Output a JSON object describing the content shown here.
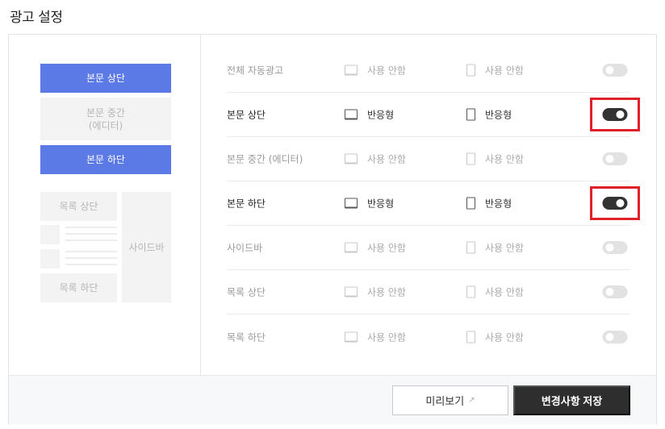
{
  "page": {
    "title": "광고 설정"
  },
  "preview": {
    "top": "본문 상단",
    "middle_line1": "본문 중간",
    "middle_line2": "(에디터)",
    "bottom": "본문 하단",
    "list_top": "목록 상단",
    "list_bottom": "목록 하단",
    "sidebar": "사이드바"
  },
  "rows": [
    {
      "label": "전체 자동광고",
      "pc": "사용 안함",
      "mobile": "사용 안함",
      "enabled": false
    },
    {
      "label": "본문 상단",
      "pc": "반응형",
      "mobile": "반응형",
      "enabled": true
    },
    {
      "label": "본문 중간 (에디터)",
      "pc": "사용 안함",
      "mobile": "사용 안함",
      "enabled": false
    },
    {
      "label": "본문 하단",
      "pc": "반응형",
      "mobile": "반응형",
      "enabled": true
    },
    {
      "label": "사이드바",
      "pc": "사용 안함",
      "mobile": "사용 안함",
      "enabled": false
    },
    {
      "label": "목록 상단",
      "pc": "사용 안함",
      "mobile": "사용 안함",
      "enabled": false
    },
    {
      "label": "목록 하단",
      "pc": "사용 안함",
      "mobile": "사용 안함",
      "enabled": false
    }
  ],
  "footer": {
    "preview_button": "미리보기",
    "save_button": "변경사항 저장"
  },
  "colors": {
    "accent": "#5b7ae6",
    "highlight": "#e0202b",
    "toggle_on": "#333333"
  }
}
